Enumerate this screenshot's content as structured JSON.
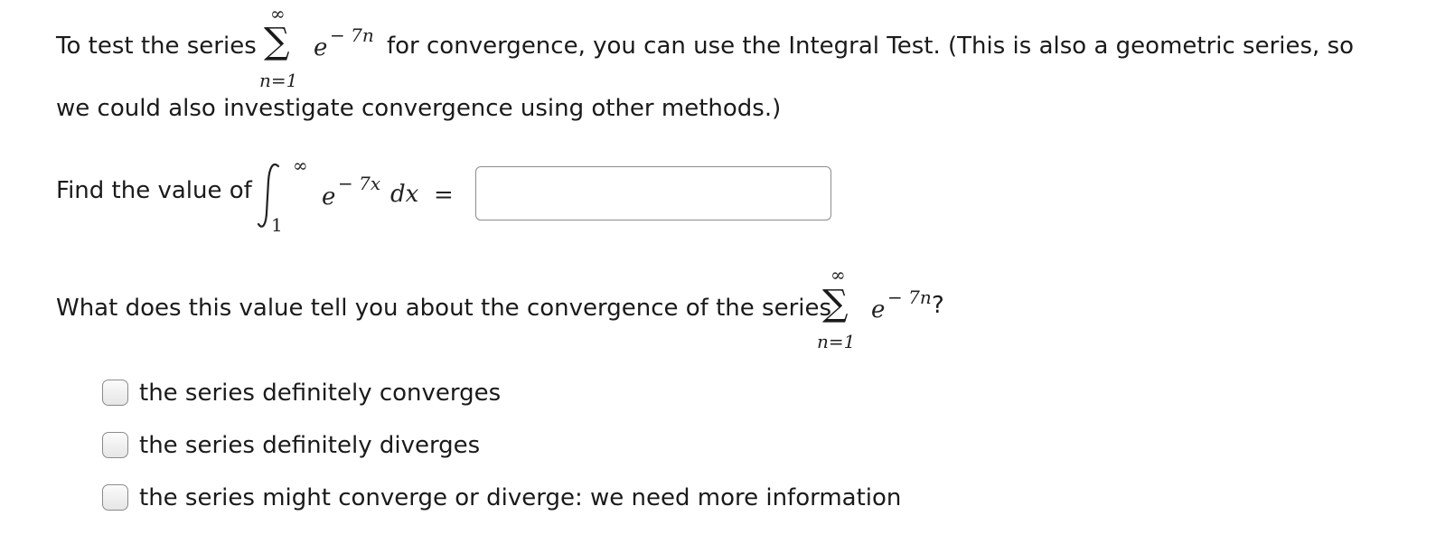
{
  "intro": {
    "before": "To test the series",
    "sum_lower": "n=1",
    "sum_upper": "∞",
    "term_base": "e",
    "term_exp": "− 7n",
    "after": "for convergence, you can use the Integral Test. (This is also a geometric series, so",
    "line2": "we could also investigate convergence using other methods.)"
  },
  "integral": {
    "prompt": "Find the value of",
    "lower": "1",
    "upper": "∞",
    "base": "e",
    "exp": "− 7x",
    "dx": "dx",
    "equals": "=",
    "answer_value": ""
  },
  "question": {
    "text": "What does this value tell you about the convergence of the series",
    "sum_upper": "∞",
    "sum_lower": "n=1",
    "term_base": "e",
    "term_exp": "− 7n",
    "end": "?"
  },
  "options": [
    {
      "label": "the series definitely converges",
      "checked": false
    },
    {
      "label": "the series definitely diverges",
      "checked": false
    },
    {
      "label": "the series might converge or diverge: we need more information",
      "checked": false
    }
  ]
}
